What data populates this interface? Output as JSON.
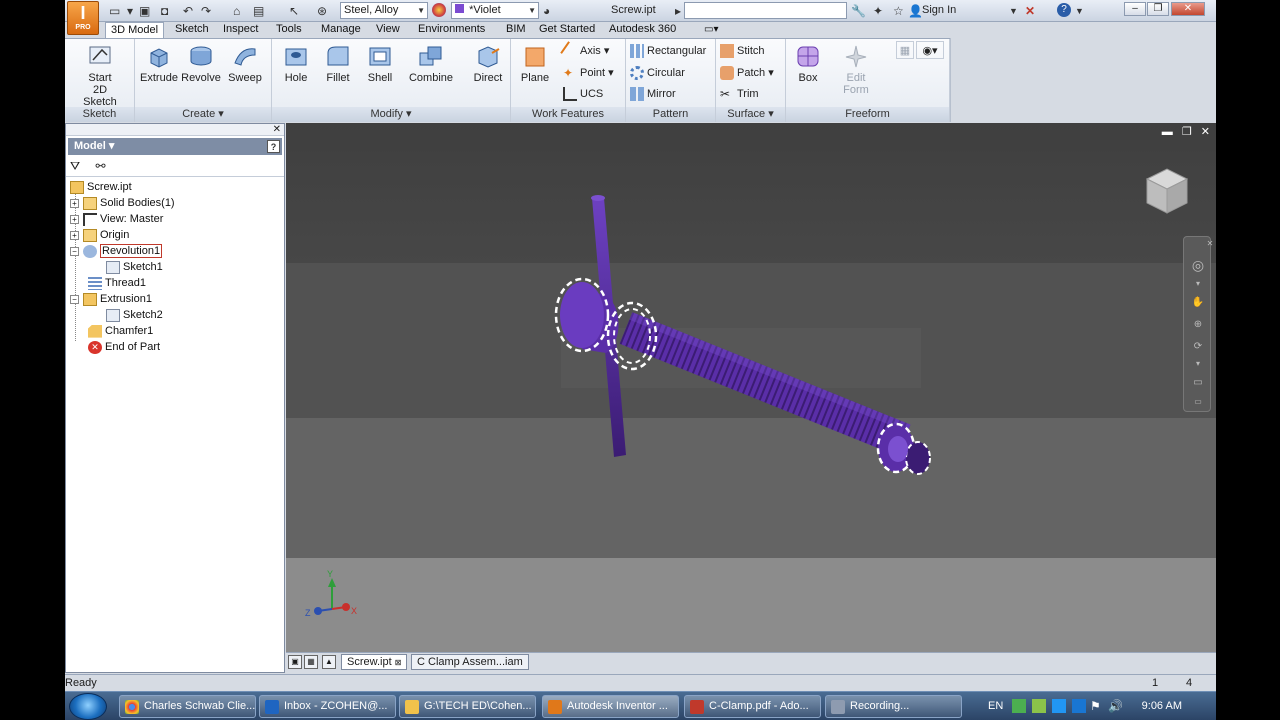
{
  "colors": {
    "part_purple": "#5a2ea8",
    "part_dark": "#3b1c73",
    "viewport_bg": "#474747"
  },
  "titlebar": {
    "app_badge": "PRO",
    "material": "Steel, Alloy",
    "appearance": "*Violet",
    "document": "Screw.ipt",
    "search_placeholder": "",
    "sign_in": "Sign In"
  },
  "tabs": [
    "3D Model",
    "Sketch",
    "Inspect",
    "Tools",
    "Manage",
    "View",
    "Environments",
    "BIM",
    "Get Started",
    "Autodesk 360"
  ],
  "ribbon": {
    "sketch": {
      "title": "Sketch",
      "start_line1": "Start",
      "start_line2": "2D Sketch"
    },
    "create": {
      "title": "Create",
      "extrude": "Extrude",
      "revolve": "Revolve",
      "sweep": "Sweep"
    },
    "modify": {
      "title": "Modify",
      "hole": "Hole",
      "fillet": "Fillet",
      "shell": "Shell",
      "combine": "Combine",
      "direct": "Direct"
    },
    "work_features": {
      "title": "Work Features",
      "plane": "Plane",
      "axis": "Axis",
      "point": "Point",
      "ucs": "UCS"
    },
    "pattern": {
      "title": "Pattern",
      "rectangular": "Rectangular",
      "circular": "Circular",
      "mirror": "Mirror"
    },
    "surface": {
      "title": "Surface",
      "stitch": "Stitch",
      "patch": "Patch",
      "trim": "Trim"
    },
    "freeform": {
      "title": "Freeform",
      "box": "Box",
      "edit_form_line1": "Edit",
      "edit_form_line2": "Form"
    }
  },
  "browser": {
    "header": "Model",
    "tree": [
      {
        "label": "Screw.ipt"
      },
      {
        "label": "Solid Bodies(1)"
      },
      {
        "label": "View: Master"
      },
      {
        "label": "Origin"
      },
      {
        "label": "Revolution1"
      },
      {
        "label": "Sketch1"
      },
      {
        "label": "Thread1"
      },
      {
        "label": "Extrusion1"
      },
      {
        "label": "Sketch2"
      },
      {
        "label": "Chamfer1"
      },
      {
        "label": "End of Part"
      }
    ]
  },
  "viewport": {
    "triad": {
      "x": "X",
      "y": "Y",
      "z": "Z"
    }
  },
  "doc_tabs": [
    "Screw.ipt",
    "C Clamp Assem...iam"
  ],
  "status": {
    "text": "Ready",
    "count1": "1",
    "count2": "4"
  },
  "taskbar": {
    "items": [
      "Charles Schwab Clie...",
      "Inbox - ZCOHEN@...",
      "G:\\TECH ED\\Cohen...",
      "Autodesk Inventor ...",
      "C-Clamp.pdf - Ado...",
      "Recording..."
    ],
    "lang": "EN",
    "time": "9:06 AM"
  }
}
